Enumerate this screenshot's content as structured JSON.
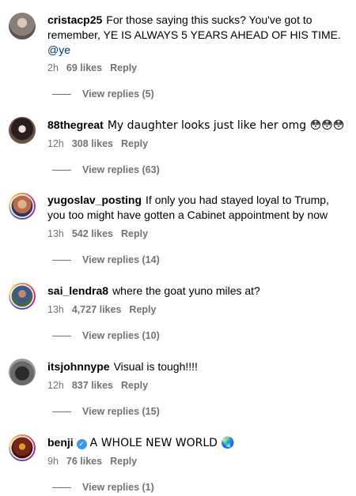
{
  "comments": [
    {
      "username": "cristacp25",
      "text": "For those saying this sucks? You've got to remember, YE IS ALWAYS 5 YEARS AHEAD OF HIS TIME.",
      "mention": "@ye",
      "time": "2h",
      "likes": "69 likes",
      "reply": "Reply",
      "view_replies": "View replies (5)",
      "avatar_color": "#8a7f78"
    },
    {
      "username": "88thegreat",
      "text": "My daughter looks just like her omg 😳😳😳",
      "time": "12h",
      "likes": "308 likes",
      "reply": "Reply",
      "view_replies": "View replies (63)",
      "avatar_color": "#3a2a2a"
    },
    {
      "username": "yugoslav_posting",
      "text": "If only you had stayed loyal to Trump, you too might have gotten a Cabinet appointment by now",
      "time": "13h",
      "likes": "542 likes",
      "reply": "Reply",
      "view_replies": "View replies (14)",
      "avatar_color": "#b86a4a"
    },
    {
      "username": "sai_lendra8",
      "text": "where the goat yuno miles at?",
      "time": "13h",
      "likes": "4,727 likes",
      "reply": "Reply",
      "view_replies": "View replies (10)",
      "avatar_color": "#4a6a3a"
    },
    {
      "username": "itsjohnnype",
      "text": "Visual is tough!!!!",
      "time": "12h",
      "likes": "837 likes",
      "reply": "Reply",
      "view_replies": "View replies (15)",
      "avatar_color": "#5a5a5a"
    },
    {
      "username": "benji",
      "text": "A WHOLE NEW WORLD 🌏",
      "time": "9h",
      "likes": "76 likes",
      "reply": "Reply",
      "view_replies": "View replies (1)",
      "avatar_color": "#7a2418",
      "verified_icon": "verified-badge-icon"
    }
  ],
  "colors": {
    "meta_text": "#737373",
    "mention": "#00376b",
    "verified": "#3897f0"
  }
}
